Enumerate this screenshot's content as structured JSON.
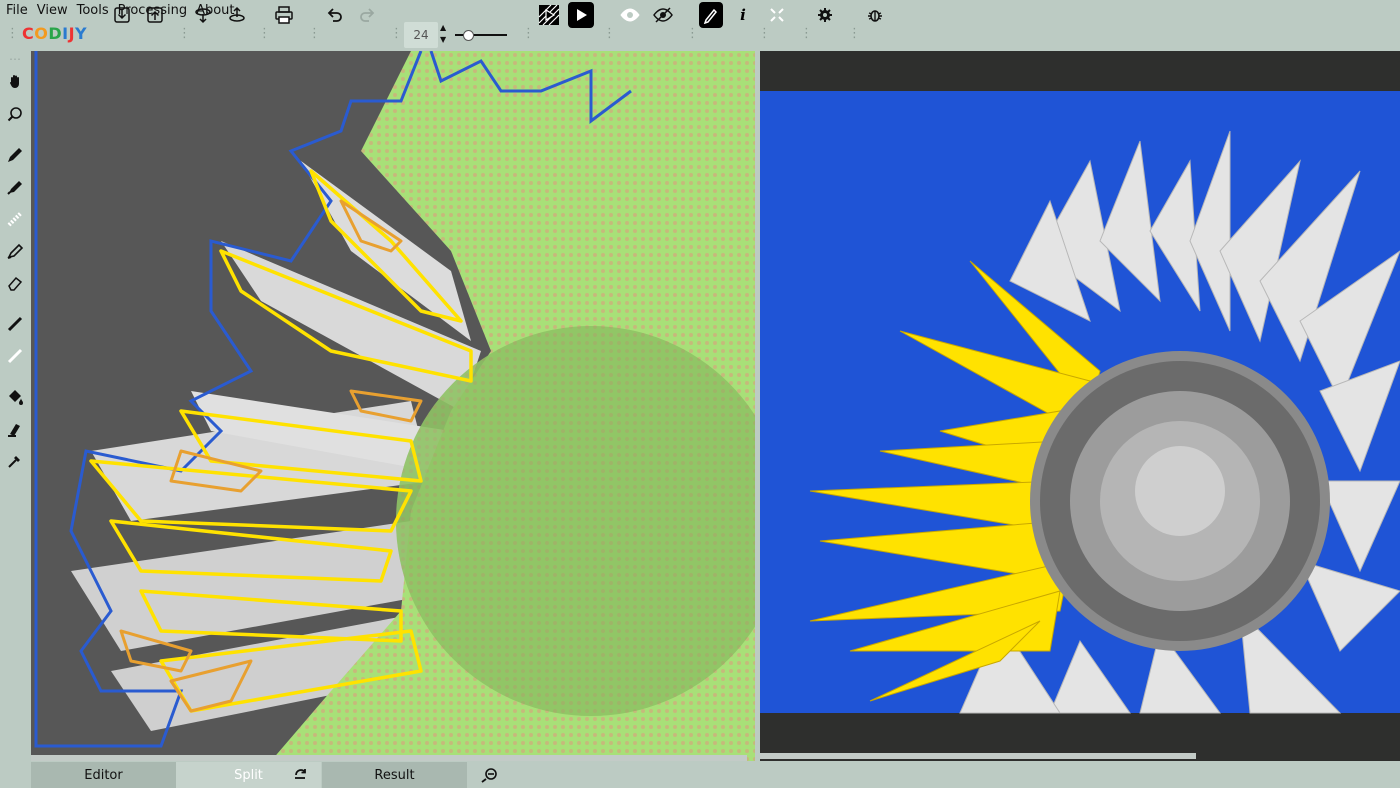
{
  "menu": [
    "File",
    "View",
    "Tools",
    "Processing",
    "About"
  ],
  "logo": {
    "text": "CODIJY"
  },
  "toolbar": {
    "zoom_value": "24",
    "icons": [
      "import-icon",
      "export-icon",
      "load-markers-icon",
      "save-markers-icon",
      "print-icon",
      "undo-icon",
      "redo-icon",
      "zoom-slider",
      "preview-icon",
      "run-colorize-icon",
      "show-markers-icon",
      "hide-markers-icon",
      "pen-mode-icon",
      "info-icon",
      "fit-icon",
      "settings-icon",
      "bug-icon"
    ]
  },
  "sidebar": {
    "tools": [
      "move-icon",
      "pan-icon",
      "zoom-icon",
      "pencil-icon",
      "marker-icon",
      "dotted-brush-icon",
      "brush-icon",
      "eraser-icon",
      "connect-icon",
      "line-icon",
      "fill-icon",
      "stamp-icon",
      "eyedropper-icon"
    ]
  },
  "colors": {
    "accent_blue": "#2a5bd0",
    "marker_yellow": "#ffe200",
    "marker_orange": "#e8a030",
    "marker_green": "#8fd86a",
    "sky_blue": "#1f54d6",
    "background": "#bccbc3"
  },
  "tabs": {
    "editor": "Editor",
    "split": "Split",
    "result": "Result"
  }
}
